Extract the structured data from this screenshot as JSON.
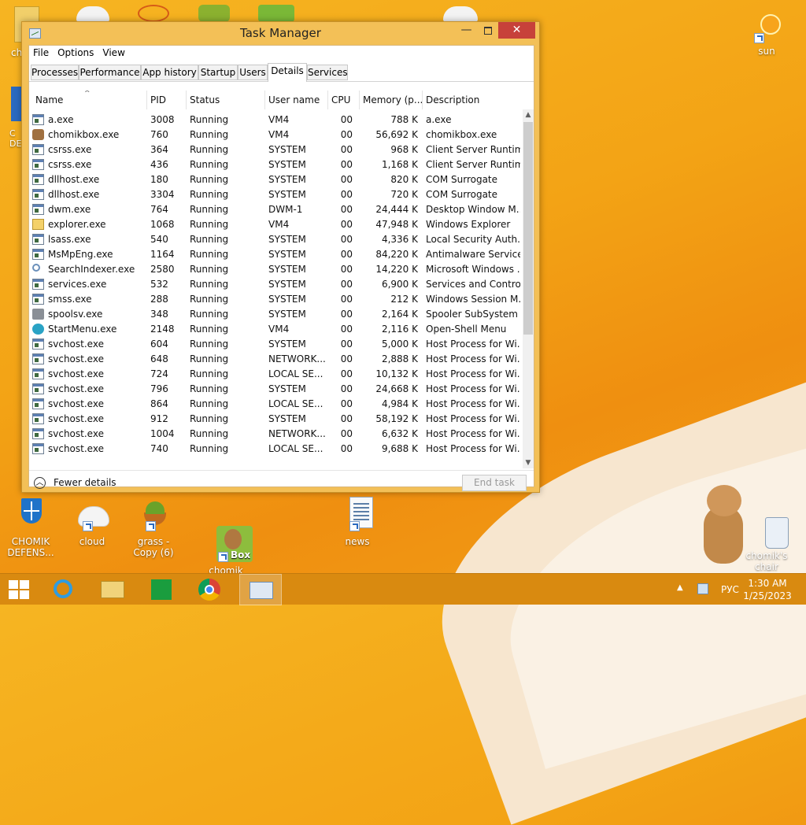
{
  "desktop": {
    "top_partial": [
      {
        "name": "chomik-left-partial",
        "label": "ch"
      },
      {
        "name": "sun-shortcut",
        "label": "sun"
      }
    ],
    "left_icon_partial": {
      "label": "C\nDE"
    },
    "icons": [
      {
        "label": "CHOMIK DEFENS..."
      },
      {
        "label": "cloud"
      },
      {
        "label": "grass - Copy (6)"
      },
      {
        "label": "chomik"
      },
      {
        "label": "news"
      },
      {
        "label": "chomik's chair"
      }
    ]
  },
  "window": {
    "title": "Task Manager",
    "controls": {
      "minimize": "—",
      "close": "✕"
    },
    "menu": [
      "File",
      "Options",
      "View"
    ],
    "tabs": [
      "Processes",
      "Performance",
      "App history",
      "Startup",
      "Users",
      "Details",
      "Services"
    ],
    "active_tab": "Details",
    "columns": [
      "Name",
      "PID",
      "Status",
      "User name",
      "CPU",
      "Memory (p...",
      "Description"
    ],
    "rows": [
      {
        "icon": "exe",
        "name": "a.exe",
        "pid": "3008",
        "status": "Running",
        "user": "VM4",
        "cpu": "00",
        "mem": "788 K",
        "desc": "a.exe"
      },
      {
        "icon": "chomik",
        "name": "chomikbox.exe",
        "pid": "760",
        "status": "Running",
        "user": "VM4",
        "cpu": "00",
        "mem": "56,692 K",
        "desc": "chomikbox.exe"
      },
      {
        "icon": "exe",
        "name": "csrss.exe",
        "pid": "364",
        "status": "Running",
        "user": "SYSTEM",
        "cpu": "00",
        "mem": "968 K",
        "desc": "Client Server Runtim..."
      },
      {
        "icon": "exe",
        "name": "csrss.exe",
        "pid": "436",
        "status": "Running",
        "user": "SYSTEM",
        "cpu": "00",
        "mem": "1,168 K",
        "desc": "Client Server Runtim..."
      },
      {
        "icon": "exe",
        "name": "dllhost.exe",
        "pid": "180",
        "status": "Running",
        "user": "SYSTEM",
        "cpu": "00",
        "mem": "820 K",
        "desc": "COM Surrogate"
      },
      {
        "icon": "exe",
        "name": "dllhost.exe",
        "pid": "3304",
        "status": "Running",
        "user": "SYSTEM",
        "cpu": "00",
        "mem": "720 K",
        "desc": "COM Surrogate"
      },
      {
        "icon": "exe",
        "name": "dwm.exe",
        "pid": "764",
        "status": "Running",
        "user": "DWM-1",
        "cpu": "00",
        "mem": "24,444 K",
        "desc": "Desktop Window M..."
      },
      {
        "icon": "explorer",
        "name": "explorer.exe",
        "pid": "1068",
        "status": "Running",
        "user": "VM4",
        "cpu": "00",
        "mem": "47,948 K",
        "desc": "Windows Explorer"
      },
      {
        "icon": "exe",
        "name": "lsass.exe",
        "pid": "540",
        "status": "Running",
        "user": "SYSTEM",
        "cpu": "00",
        "mem": "4,336 K",
        "desc": "Local Security Auth..."
      },
      {
        "icon": "exe",
        "name": "MsMpEng.exe",
        "pid": "1164",
        "status": "Running",
        "user": "SYSTEM",
        "cpu": "00",
        "mem": "84,220 K",
        "desc": "Antimalware Service..."
      },
      {
        "icon": "search",
        "name": "SearchIndexer.exe",
        "pid": "2580",
        "status": "Running",
        "user": "SYSTEM",
        "cpu": "00",
        "mem": "14,220 K",
        "desc": "Microsoft Windows ..."
      },
      {
        "icon": "exe",
        "name": "services.exe",
        "pid": "532",
        "status": "Running",
        "user": "SYSTEM",
        "cpu": "00",
        "mem": "6,900 K",
        "desc": "Services and Control..."
      },
      {
        "icon": "exe",
        "name": "smss.exe",
        "pid": "288",
        "status": "Running",
        "user": "SYSTEM",
        "cpu": "00",
        "mem": "212 K",
        "desc": "Windows Session M..."
      },
      {
        "icon": "printer",
        "name": "spoolsv.exe",
        "pid": "348",
        "status": "Running",
        "user": "SYSTEM",
        "cpu": "00",
        "mem": "2,164 K",
        "desc": "Spooler SubSystem ..."
      },
      {
        "icon": "start",
        "name": "StartMenu.exe",
        "pid": "2148",
        "status": "Running",
        "user": "VM4",
        "cpu": "00",
        "mem": "2,116 K",
        "desc": "Open-Shell Menu"
      },
      {
        "icon": "exe",
        "name": "svchost.exe",
        "pid": "604",
        "status": "Running",
        "user": "SYSTEM",
        "cpu": "00",
        "mem": "5,000 K",
        "desc": "Host Process for Wi..."
      },
      {
        "icon": "exe",
        "name": "svchost.exe",
        "pid": "648",
        "status": "Running",
        "user": "NETWORK...",
        "cpu": "00",
        "mem": "2,888 K",
        "desc": "Host Process for Wi..."
      },
      {
        "icon": "exe",
        "name": "svchost.exe",
        "pid": "724",
        "status": "Running",
        "user": "LOCAL SE...",
        "cpu": "00",
        "mem": "10,132 K",
        "desc": "Host Process for Wi..."
      },
      {
        "icon": "exe",
        "name": "svchost.exe",
        "pid": "796",
        "status": "Running",
        "user": "SYSTEM",
        "cpu": "00",
        "mem": "24,668 K",
        "desc": "Host Process for Wi..."
      },
      {
        "icon": "exe",
        "name": "svchost.exe",
        "pid": "864",
        "status": "Running",
        "user": "LOCAL SE...",
        "cpu": "00",
        "mem": "4,984 K",
        "desc": "Host Process for Wi..."
      },
      {
        "icon": "exe",
        "name": "svchost.exe",
        "pid": "912",
        "status": "Running",
        "user": "SYSTEM",
        "cpu": "00",
        "mem": "58,192 K",
        "desc": "Host Process for Wi..."
      },
      {
        "icon": "exe",
        "name": "svchost.exe",
        "pid": "1004",
        "status": "Running",
        "user": "NETWORK...",
        "cpu": "00",
        "mem": "6,632 K",
        "desc": "Host Process for Wi..."
      },
      {
        "icon": "exe",
        "name": "svchost.exe",
        "pid": "740",
        "status": "Running",
        "user": "LOCAL SE...",
        "cpu": "00",
        "mem": "9,688 K",
        "desc": "Host Process for Wi..."
      }
    ],
    "fewer_details": "Fewer details",
    "end_task": "End task"
  },
  "taskbar": {
    "items": [
      "start-button",
      "internet-explorer",
      "file-explorer",
      "store",
      "chrome",
      "task-manager"
    ],
    "language": "РУС",
    "time": "1:30 AM",
    "date": "1/25/2023"
  },
  "colors": {
    "accent": "#f3c057",
    "close": "#c7413a",
    "taskbar": "#d98a10"
  }
}
